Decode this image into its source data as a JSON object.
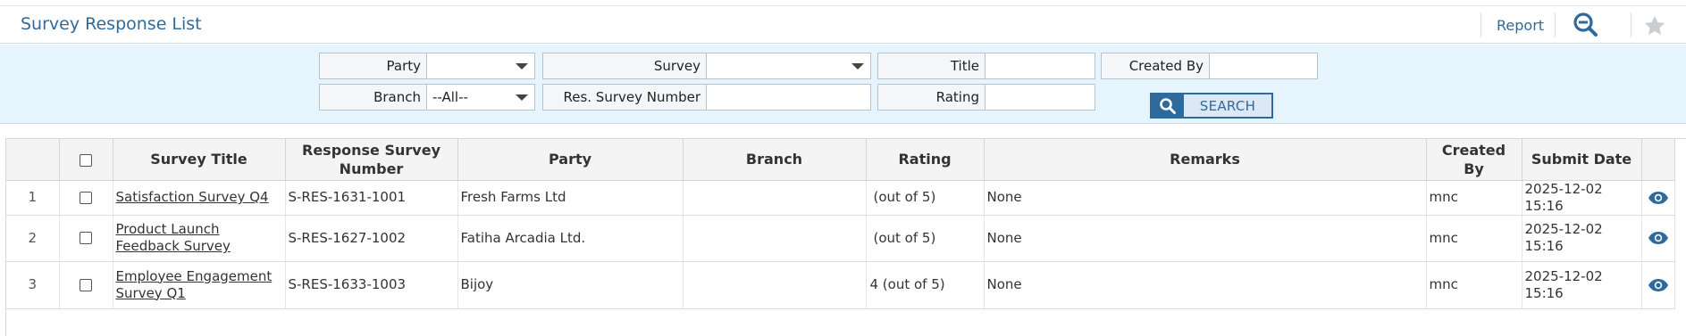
{
  "header": {
    "title": "Survey Response List",
    "report_label": "Report",
    "zoom_icon": "zoom-out-icon",
    "star_icon": "star-icon"
  },
  "filters": {
    "party": {
      "label": "Party",
      "value": ""
    },
    "survey": {
      "label": "Survey",
      "value": ""
    },
    "title": {
      "label": "Title",
      "value": ""
    },
    "created_by": {
      "label": "Created By",
      "value": ""
    },
    "branch": {
      "label": "Branch",
      "value": "--All--"
    },
    "res_survey_number": {
      "label": "Res. Survey Number",
      "value": ""
    },
    "rating": {
      "label": "Rating",
      "value": ""
    },
    "search_label": "SEARCH"
  },
  "table": {
    "headers": {
      "survey_title": "Survey Title",
      "response_number": "Response Survey Number",
      "party": "Party",
      "branch": "Branch",
      "rating": "Rating",
      "remarks": "Remarks",
      "created_by": "Created By",
      "submit_date": "Submit Date"
    },
    "rows": [
      {
        "num": "1",
        "title": "Satisfaction Survey Q4",
        "response_number": "S-RES-1631-1001",
        "party": "Fresh Farms Ltd",
        "branch": "",
        "rating": "(out of 5)",
        "remarks": "None",
        "created_by": "mnc",
        "submit_date": "2025-12-02 15:16"
      },
      {
        "num": "2",
        "title": "Product Launch Feedback Survey",
        "response_number": "S-RES-1627-1002",
        "party": "Fatiha Arcadia Ltd.",
        "branch": "",
        "rating": "(out of 5)",
        "remarks": "None",
        "created_by": "mnc",
        "submit_date": "2025-12-02 15:16"
      },
      {
        "num": "3",
        "title": "Employee Engagement Survey Q1",
        "response_number": "S-RES-1633-1003",
        "party": "Bijoy",
        "branch": "",
        "rating": "4 (out of 5)",
        "remarks": "None",
        "created_by": "mnc",
        "submit_date": "2025-12-02 15:16"
      }
    ]
  },
  "colors": {
    "accent": "#2f6a9c",
    "filter_bg": "#e6f4fd",
    "header_bg": "#f4f4f4"
  }
}
